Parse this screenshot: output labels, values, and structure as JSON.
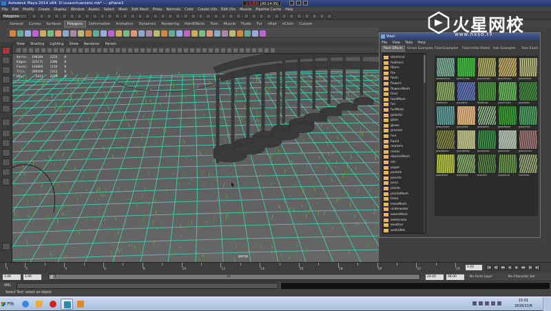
{
  "title_bar": {
    "title": "Autodesk Maya 2014 x64: D:\\xuanchuanleisi.mb* --- pPlane1",
    "recording_label": "正在录制",
    "recording_time": "[00:14:35]"
  },
  "main_menu": [
    "File",
    "Edit",
    "Modify",
    "Create",
    "Display",
    "Window",
    "Assets",
    "Select",
    "Mesh",
    "Edit Mesh",
    "Proxy",
    "Normals",
    "Color",
    "Create UVs",
    "Edit UVs",
    "Muscle",
    "Pipeline Cache",
    "Help"
  ],
  "status_line": {
    "menu_set": "Polygons"
  },
  "shelf_tabs": [
    "General",
    "Curves",
    "Surfaces",
    "Polygons",
    "Deformation",
    "Animation",
    "Dynamics",
    "Rendering",
    "PaintEffects",
    "Toon",
    "Muscle",
    "Fluids",
    "Fur",
    "nHair",
    "nCloth",
    "Custom"
  ],
  "shelf_active_tab": "Polygons",
  "panel_menu": [
    "View",
    "Shading",
    "Lighting",
    "Show",
    "Renderer",
    "Panels"
  ],
  "hud": {
    "rows": [
      {
        "label": "Verts:",
        "a": "190364",
        "b": "1225",
        "c": "0"
      },
      {
        "label": "Edges:",
        "a": "325172",
        "b": "2306",
        "c": "0"
      },
      {
        "label": "Faces:",
        "a": "144665",
        "b": "1156",
        "c": "0"
      },
      {
        "label": "Tris:",
        "a": "289458",
        "b": "2312",
        "c": "0"
      },
      {
        "label": "UVs:",
        "a": "3431",
        "b": "1229",
        "c": "0"
      }
    ]
  },
  "camera_label": "persp",
  "watermark": {
    "text": "火星网校",
    "url": "www.hxsd.tv"
  },
  "visor": {
    "title": "Visor",
    "menu": [
      "File",
      "View",
      "Tabs",
      "Help"
    ],
    "tabs": [
      "Paint Effects",
      "Ocean Examples",
      "Fluid Examples",
      "Fluid Initial States",
      "Hair Examples",
      "Toon Exam"
    ],
    "active_tab": "Paint Effects",
    "folders": [
      "electrical",
      "feathers",
      "fibers",
      "fire",
      "flesh",
      "flowers",
      "flowersMesh",
      "food",
      "foodMesh",
      "fun",
      "funMesh",
      "galactic",
      "glass",
      "glows",
      "grasses",
      "hair",
      "liquid",
      "markers",
      "metal",
      "objectsMesh",
      "oils",
      "paper",
      "pastels",
      "pencils",
      "pens",
      "plants",
      "plantsMesh",
      "trees",
      "treesMesh",
      "underwater",
      "waterMesh",
      "watercolor",
      "weather",
      "wetInWet"
    ],
    "thumbs": [
      {
        "cap": "bambooGras",
        "color": "#4e7a6a",
        "accent": "#9bb7a3"
      },
      {
        "cap": "grassClump",
        "color": "#2a8f2a",
        "accent": "#55c24a"
      },
      {
        "cap": "grassOrnam",
        "color": "#6c7040",
        "accent": "#c9c27a"
      },
      {
        "cap": "grassOrnam",
        "color": "#7d6d3a",
        "accent": "#d6c58a"
      },
      {
        "cap": "grassWindy",
        "color": "#6a7040",
        "accent": "#d9d3a1"
      },
      {
        "cap": "feathersGr",
        "color": "#5a7040",
        "accent": "#a6c27a"
      },
      {
        "cap": "grassBlue",
        "color": "#3c4a7a",
        "accent": "#7a8ac8"
      },
      {
        "cap": "fieldGrass",
        "color": "#2e6a2e",
        "accent": "#66a84a"
      },
      {
        "cap": "grassCrowd",
        "color": "#3a7a3a",
        "accent": "#8acb6a"
      },
      {
        "cap": "grassDark",
        "color": "#2a5a2a",
        "accent": "#58944a"
      },
      {
        "cap": "grassOrnam",
        "color": "#3b6a6a",
        "accent": "#7ab2a8"
      },
      {
        "cap": "grassWide",
        "color": "#b08a5a",
        "accent": "#e6c49a"
      },
      {
        "cap": "grassWind",
        "color": "#3a5a3a",
        "accent": "#c8d4b8"
      },
      {
        "cap": "greenBlade",
        "color": "#1f6a1f",
        "accent": "#55b04a"
      },
      {
        "cap": "grassThick",
        "color": "#2a6a3a",
        "accent": "#6ab07a"
      },
      {
        "cap": "grassBrown",
        "color": "#4a4f2a",
        "accent": "#9aa05a"
      },
      {
        "cap": "grassWindy",
        "color": "#b7b08a",
        "accent": "#8a9a5a"
      },
      {
        "cap": "grassGreen",
        "color": "#1e5a2a",
        "accent": "#58a05a"
      },
      {
        "cap": "grassSeed",
        "color": "#8a9a8a",
        "accent": "#c0c8c0"
      },
      {
        "cap": "grassOrnam",
        "color": "#6a4a4a",
        "accent": "#b08a8a"
      },
      {
        "cap": "grassShort",
        "color": "#7a8a2a",
        "accent": "#c8d45a"
      },
      {
        "cap": "grassLong",
        "color": "#4a6a3a",
        "accent": "#a8c08a"
      },
      {
        "cap": "grassTall",
        "color": "#2a4a2a",
        "accent": "#7aa05a"
      },
      {
        "cap": "jungleGras",
        "color": "#3a5a2a",
        "accent": "#8ab06a"
      },
      {
        "cap": "lushGrass",
        "color": "#4a5a3a",
        "accent": "#c0c8a0"
      }
    ]
  },
  "time_slider": {
    "ticks": [
      "1",
      "2",
      "4",
      "6",
      "8",
      "10",
      "12",
      "14",
      "16",
      "18",
      "20",
      "22",
      "24"
    ],
    "current_frame": "1.00"
  },
  "range_slider": {
    "start": "1.00",
    "inner_start": "1.00",
    "inner_start_label": "1",
    "range_value": "24",
    "inner_end": "24.00",
    "end": "48.00",
    "anim_layer": "No Anim Layer",
    "character_set": "No Character Set"
  },
  "command_line": {
    "label": "MEL"
  },
  "help_line": "Select Tool: select an object",
  "taskbar": {
    "start_label": "开始",
    "time": "15:01",
    "date": "2016/11/6"
  }
}
